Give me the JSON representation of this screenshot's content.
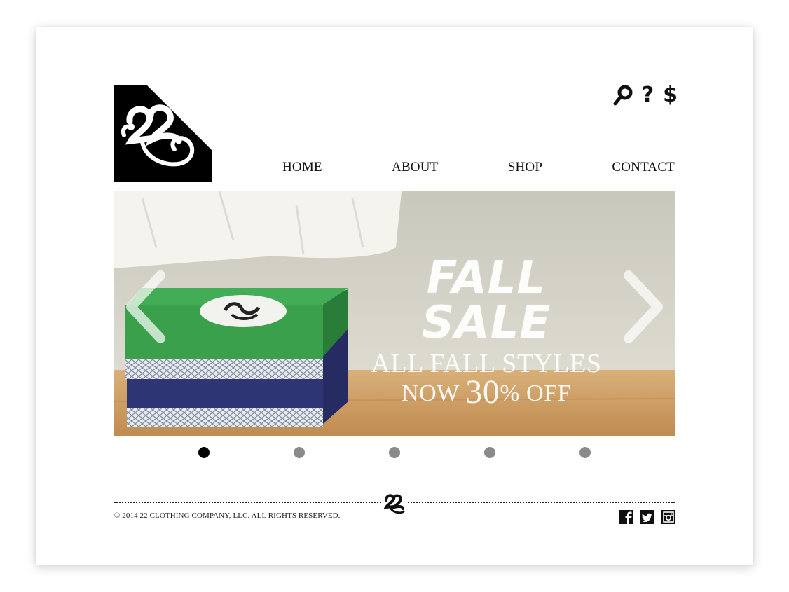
{
  "header": {
    "logo_text": "22",
    "icons": [
      "search-icon",
      "help-icon",
      "dollar-icon"
    ],
    "help_glyph": "?",
    "dollar_glyph": "$"
  },
  "nav": {
    "items": [
      "HOME",
      "ABOUT",
      "SHOP",
      "CONTACT"
    ]
  },
  "hero": {
    "headline": "FALL SALE",
    "line2": "ALL FALL STYLES",
    "line3_pre": "NOW",
    "line3_num": "30",
    "line3_post": "% OFF",
    "slide_count": 5,
    "active_slide": 1
  },
  "footer": {
    "copyright": "© 2014 22 CLOTHING COMPANY, LLC. ALL RIGHTS RESERVED.",
    "social": [
      "facebook-icon",
      "twitter-icon",
      "instagram-icon"
    ]
  },
  "colors": {
    "text": "#111111",
    "box_green": "#3aa04c",
    "box_navy": "#2e3575",
    "wood": "#c89a5b",
    "wall": "#d8d5c8"
  }
}
